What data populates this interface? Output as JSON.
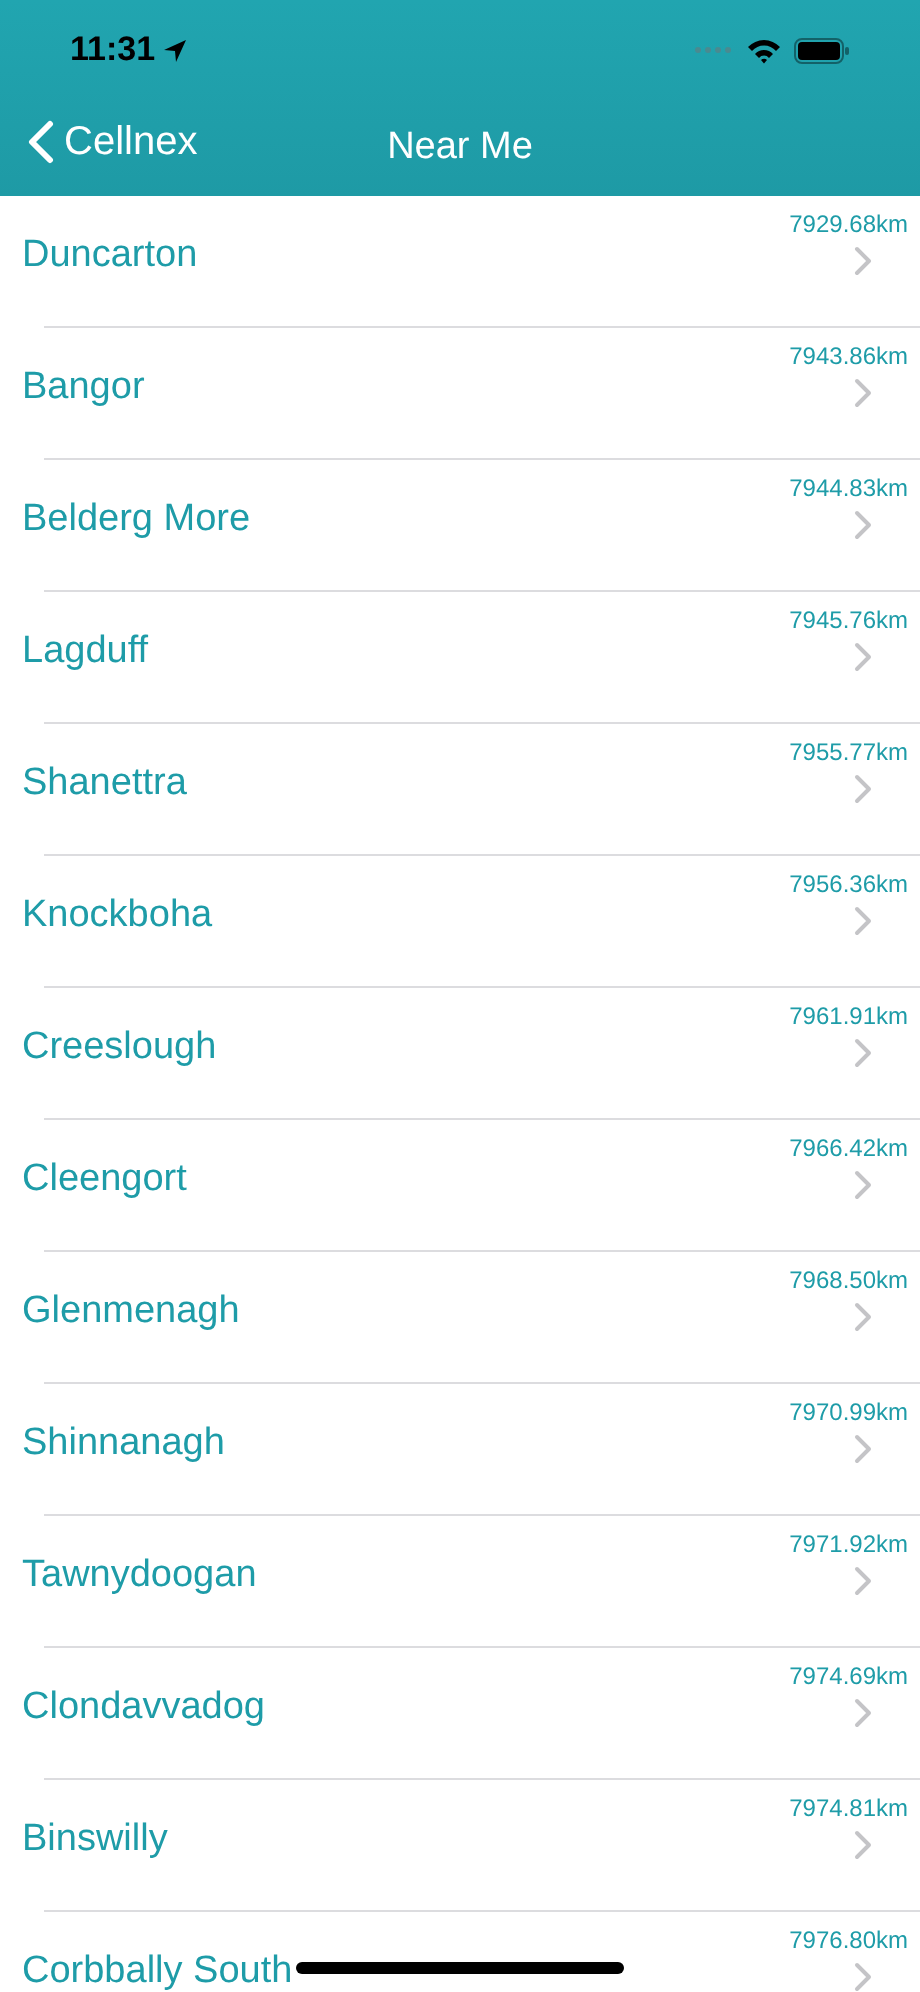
{
  "status_bar": {
    "time": "11:31"
  },
  "nav_bar": {
    "back": "Cellnex",
    "title": "Near Me"
  },
  "rows": [
    {
      "name": "Duncarton",
      "distance": "7929.68km"
    },
    {
      "name": "Bangor",
      "distance": "7943.86km"
    },
    {
      "name": "Belderg More",
      "distance": "7944.83km"
    },
    {
      "name": "Lagduff",
      "distance": "7945.76km"
    },
    {
      "name": "Shanettra",
      "distance": "7955.77km"
    },
    {
      "name": "Knockboha",
      "distance": "7956.36km"
    },
    {
      "name": "Creeslough",
      "distance": "7961.91km"
    },
    {
      "name": "Cleengort",
      "distance": "7966.42km"
    },
    {
      "name": "Glenmenagh",
      "distance": "7968.50km"
    },
    {
      "name": "Shinnanagh",
      "distance": "7970.99km"
    },
    {
      "name": "Tawnydoogan",
      "distance": "7971.92km"
    },
    {
      "name": "Clondavvadog",
      "distance": "7974.69km"
    },
    {
      "name": "Binswilly",
      "distance": "7974.81km"
    },
    {
      "name": "Corbbally South",
      "distance": "7976.80km"
    }
  ]
}
